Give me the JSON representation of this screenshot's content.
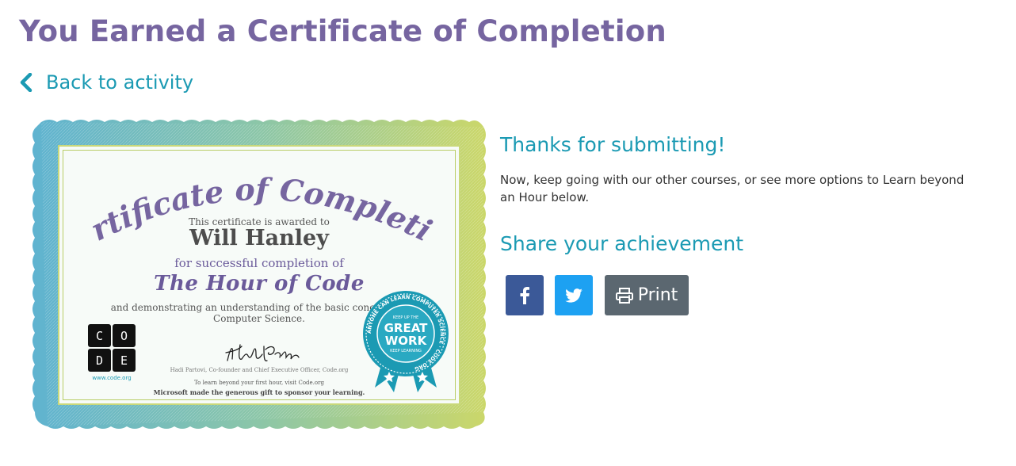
{
  "page": {
    "title": "You Earned a Certificate of Completion",
    "back_link": "Back to activity"
  },
  "certificate": {
    "heading": "Certificate of Completion",
    "awarded_text": "This certificate is awarded to",
    "recipient_name": "Will Hanley",
    "for_text": "for successful completion of",
    "course_name": "The Hour of Code",
    "demonstrating_text": "and demonstrating an understanding of the basic concepts of Computer Science.",
    "signature": "Hadi Partovi",
    "signature_caption": "Hadi Partovi, Co-founder and Chief Executive Officer, Code.org",
    "visit_text": "To learn beyond your first hour, visit Code.org",
    "sponsor_text": "Microsoft made the generous gift to sponsor your learning.",
    "logo_letters": [
      "C",
      "O",
      "D",
      "E"
    ],
    "logo_url": "www.code.org",
    "badge": {
      "ring_text": "ANYONE CAN LEARN COMPUTER SCIENCE · CODE.ORG",
      "top_text": "KEEP UP THE",
      "line1": "GREAT",
      "line2": "WORK",
      "bottom_text": "KEEP LEARNING"
    }
  },
  "side": {
    "thanks_heading": "Thanks for submitting!",
    "body": "Now, keep going with our other courses, or see more options to Learn beyond an Hour below.",
    "share_heading": "Share your achievement"
  },
  "share": {
    "facebook_icon": "facebook-icon",
    "twitter_icon": "twitter-icon",
    "print_icon": "printer-icon",
    "print_label": "Print"
  },
  "colors": {
    "title_purple": "#7665a0",
    "accent_teal": "#1b9ab3",
    "facebook_blue": "#3b5998",
    "twitter_blue": "#1da1f2",
    "print_gray": "#5b6770"
  }
}
